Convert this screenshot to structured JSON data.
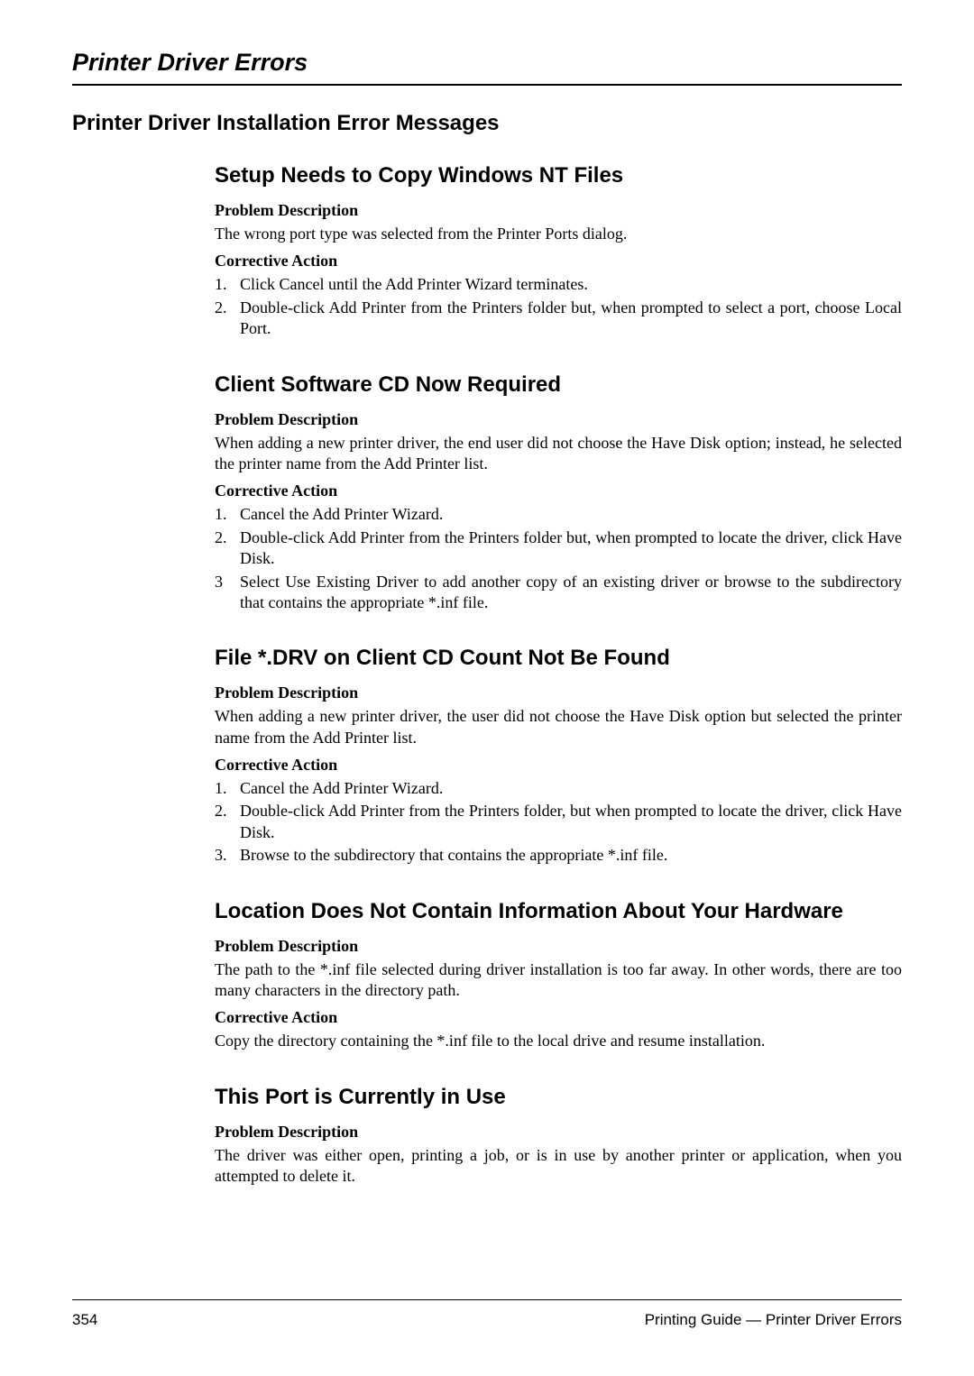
{
  "running_head": "Printer Driver Errors",
  "h1": "Printer Driver Installation Error Messages",
  "labels": {
    "problem": "Problem Description",
    "action": "Corrective Action"
  },
  "sections": [
    {
      "title": "Setup Needs to Copy Windows NT Files",
      "problem": "The wrong port type was selected from the Printer Ports dialog.",
      "action_steps": [
        {
          "n": "1.",
          "t": "Click Cancel until the Add Printer Wizard terminates."
        },
        {
          "n": "2.",
          "t": "Double-click Add Printer from the Printers folder but, when prompted to select a port, choose Local Port."
        }
      ]
    },
    {
      "title": "Client Software CD Now Required",
      "problem": "When adding a new printer driver, the end user did not choose the Have Disk option; instead, he selected the printer name from the Add Printer list.",
      "action_steps": [
        {
          "n": "1.",
          "t": "Cancel the Add Printer Wizard."
        },
        {
          "n": "2.",
          "t": "Double-click Add Printer from the Printers folder but, when prompted to locate the driver, click Have Disk."
        },
        {
          "n": "3",
          "t": "Select Use Existing Driver to add another copy of an existing driver or browse to the subdirectory that contains the appropriate *.inf file."
        }
      ]
    },
    {
      "title": "File *.DRV on Client CD Count Not Be Found",
      "problem": "When adding a new printer driver, the user did not choose the Have Disk option but selected the printer name from the Add Printer list.",
      "action_steps": [
        {
          "n": "1.",
          "t": "Cancel the Add Printer Wizard."
        },
        {
          "n": "2.",
          "t": "Double-click Add Printer from the Printers folder, but when prompted to locate the driver, click Have Disk."
        },
        {
          "n": "3.",
          "t": "Browse to the subdirectory that contains the appropriate *.inf file."
        }
      ]
    },
    {
      "title": "Location Does Not Contain Information About Your Hardware",
      "problem": "The path to the *.inf file selected during driver installation is too far away. In other words, there are too many characters in the directory path.",
      "action_text": "Copy the directory containing the *.inf file to the local drive and resume installation."
    },
    {
      "title": "This Port is Currently in Use",
      "problem": "The driver was either open, printing a job, or is in use by another printer or application, when you attempted to delete it."
    }
  ],
  "footer": {
    "page": "354",
    "right": "Printing Guide — Printer Driver Errors"
  }
}
